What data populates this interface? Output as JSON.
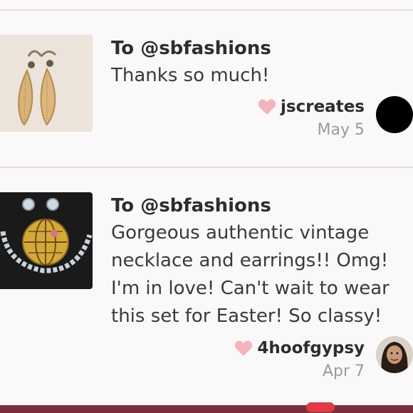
{
  "colors": {
    "heart": "#f4b4bd",
    "accent_bar": "#7a2f3a",
    "background": "#faf8f8"
  },
  "reviews": [
    {
      "to": "To @sbfashions",
      "message": "Thanks so much!",
      "author": "jscreates",
      "date": "May 5",
      "thumbnail": "gold-earrings-photo",
      "avatar": "black-avatar"
    },
    {
      "to": "To @sbfashions",
      "message": "Gorgeous authentic vintage necklace and earrings!! Omg! I'm in love! Can't wait to wear this set for Easter! So classy!",
      "author": "4hoofgypsy",
      "date": "Apr 7",
      "thumbnail": "vintage-necklace-earrings-photo",
      "avatar": "user-photo-avatar"
    }
  ]
}
